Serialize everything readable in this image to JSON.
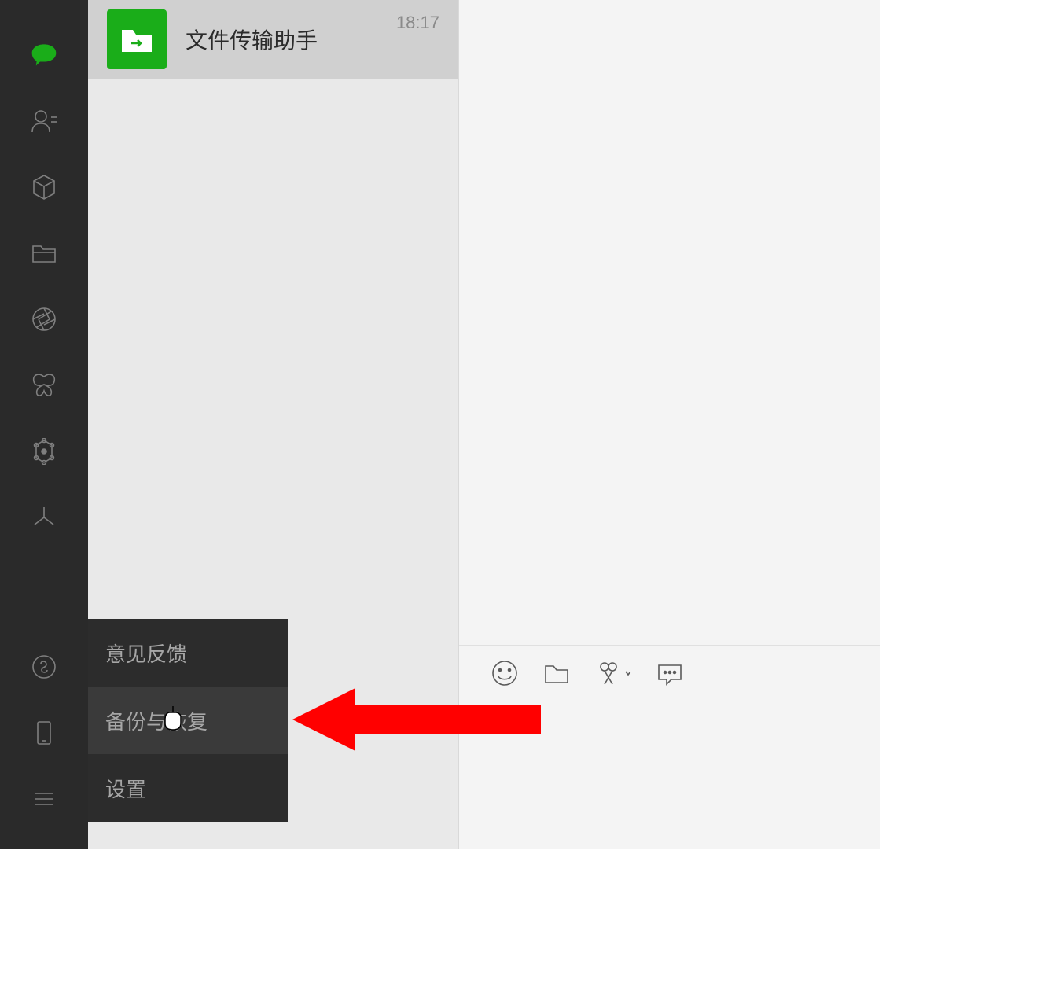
{
  "sidebar": {
    "icons": [
      {
        "name": "chat-icon",
        "active": true
      },
      {
        "name": "contacts-icon",
        "active": false
      },
      {
        "name": "cube-icon",
        "active": false
      },
      {
        "name": "folder-icon",
        "active": false
      },
      {
        "name": "aperture-icon",
        "active": false
      },
      {
        "name": "butterfly-icon",
        "active": false
      },
      {
        "name": "atom-icon",
        "active": false
      },
      {
        "name": "asterisk-icon",
        "active": false
      }
    ],
    "bottom_icons": [
      {
        "name": "miniprogram-icon"
      },
      {
        "name": "phone-icon"
      },
      {
        "name": "menu-icon"
      }
    ]
  },
  "conversations": [
    {
      "title": "文件传输助手",
      "time": "18:17",
      "avatar": "file-transfer"
    }
  ],
  "popup_menu": {
    "items": [
      {
        "label": "意见反馈",
        "hover": false
      },
      {
        "label": "备份与恢复",
        "hover": true
      },
      {
        "label": "设置",
        "hover": false
      }
    ]
  },
  "chat_toolbar": {
    "icons": [
      {
        "name": "emoji-icon"
      },
      {
        "name": "file-icon"
      },
      {
        "name": "screenshot-icon"
      },
      {
        "name": "message-icon"
      }
    ]
  }
}
